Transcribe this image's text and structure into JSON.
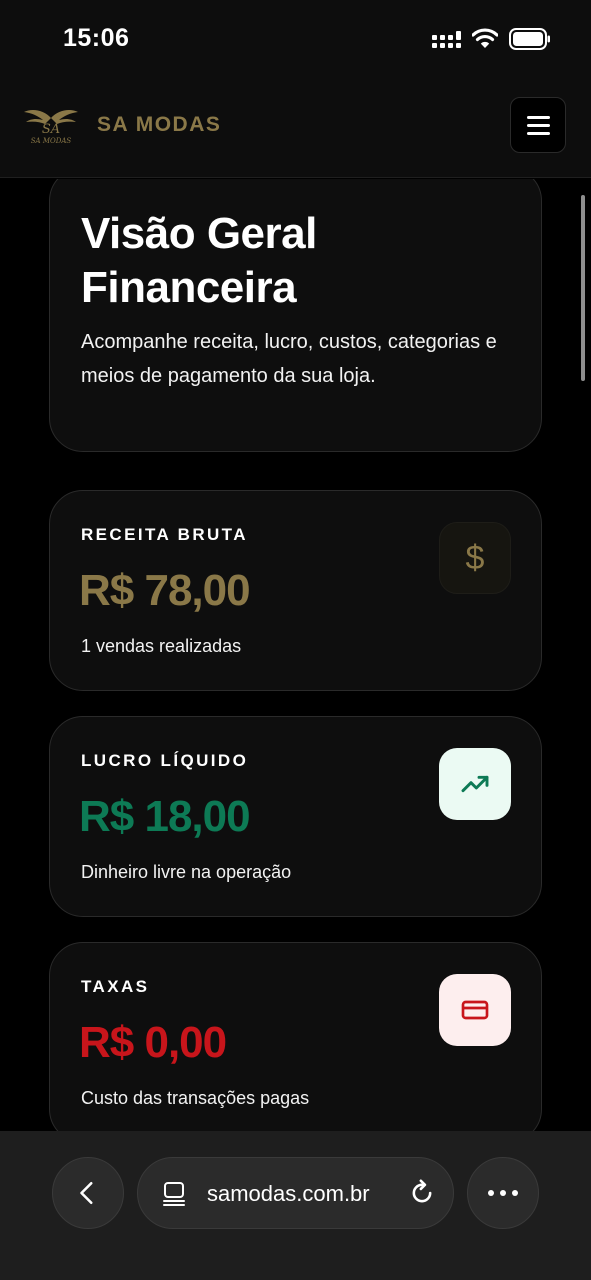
{
  "status_bar": {
    "time": "15:06"
  },
  "header": {
    "brand_name": "SA MODAS",
    "logo_text": "SA MODAS",
    "brand_color": "#8a7848"
  },
  "hero": {
    "title_line1": "Visão Geral",
    "title_line2": "Financeira",
    "description": "Acompanhe receita, lucro, custos, categorias e meios de pagamento da sua loja."
  },
  "stats": [
    {
      "label": "RECEITA BRUTA",
      "value": "R$ 78,00",
      "caption": "1 vendas realizadas",
      "icon": "dollar-icon",
      "icon_glyph": "$",
      "value_color": "#8a7848"
    },
    {
      "label": "LUCRO LÍQUIDO",
      "value": "R$ 18,00",
      "caption": "Dinheiro livre na operação",
      "icon": "trending-up-icon",
      "value_color": "#0d7a55"
    },
    {
      "label": "TAXAS",
      "value": "R$ 0,00",
      "caption": "Custo das transações pagas",
      "icon": "credit-card-icon",
      "value_color": "#c8151b"
    }
  ],
  "browser": {
    "url": "samodas.com.br",
    "back_icon": "chevron-left-icon",
    "page_icon": "page-icon",
    "reload_icon": "reload-icon",
    "more_icon": "more-icon"
  }
}
